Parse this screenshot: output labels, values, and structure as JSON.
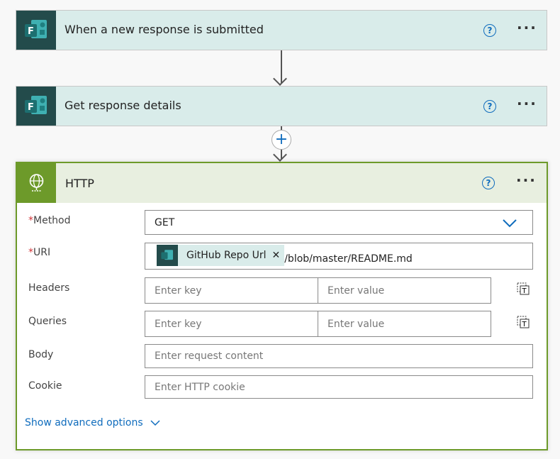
{
  "steps": [
    {
      "title": "When a new response is submitted",
      "icon": "forms-icon"
    },
    {
      "title": "Get response details",
      "icon": "forms-icon"
    }
  ],
  "http": {
    "title": "HTTP",
    "icon": "globe-icon",
    "accent": "#6d9a2a",
    "method": {
      "label": "Method",
      "value": "GET"
    },
    "uri": {
      "label": "URI",
      "token": "GitHub Repo Url",
      "suffix": "/blob/master/README.md"
    },
    "headers": {
      "label": "Headers",
      "key_placeholder": "Enter key",
      "value_placeholder": "Enter value"
    },
    "queries": {
      "label": "Queries",
      "key_placeholder": "Enter key",
      "value_placeholder": "Enter value"
    },
    "body": {
      "label": "Body",
      "placeholder": "Enter request content"
    },
    "cookie": {
      "label": "Cookie",
      "placeholder": "Enter HTTP cookie"
    },
    "advanced": "Show advanced options"
  },
  "required_mark": "*",
  "help": "?",
  "more": "···"
}
